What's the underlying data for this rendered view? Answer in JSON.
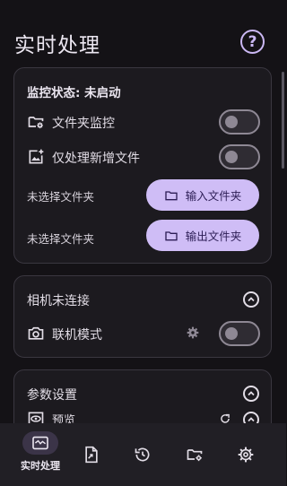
{
  "header": {
    "title": "实时处理",
    "help_icon": "help-circle-icon"
  },
  "monitor": {
    "status_text": "监控状态: 未启动",
    "folder_monitor_label": "文件夹监控",
    "folder_monitor_on": false,
    "new_files_only_label": "仅处理新增文件",
    "new_files_only_on": false,
    "input": {
      "path_text": "未选择文件夹",
      "button_label": "输入文件夹"
    },
    "output": {
      "path_text": "未选择文件夹",
      "button_label": "输出文件夹"
    }
  },
  "camera": {
    "status_text": "相机未连接",
    "tether_label": "联机模式",
    "tether_on": false
  },
  "params": {
    "title": "参数设置",
    "preview_label": "预览"
  },
  "nav": {
    "items": [
      {
        "label": "实时处理",
        "icon": "realtime-icon",
        "active": true
      },
      {
        "label": "",
        "icon": "file-export-icon",
        "active": false
      },
      {
        "label": "",
        "icon": "history-icon",
        "active": false
      },
      {
        "label": "",
        "icon": "folder-settings-icon",
        "active": false
      },
      {
        "label": "",
        "icon": "settings-icon",
        "active": false
      }
    ]
  },
  "colors": {
    "accent": "#cfbdf6",
    "background": "#141216",
    "card": "#1c1a1f",
    "nav": "#211f25"
  }
}
